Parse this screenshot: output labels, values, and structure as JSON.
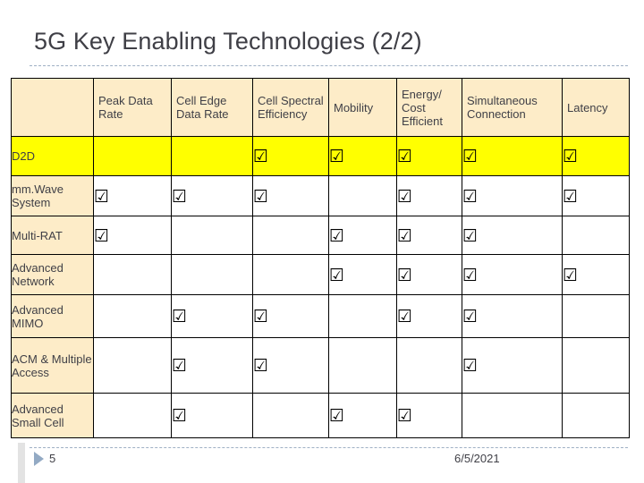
{
  "slide": {
    "title": "5G Key Enabling Technologies (2/2)",
    "footer": {
      "page_number": "5",
      "date": "6/5/2021",
      "triangle_icon": "play-triangle-icon"
    },
    "colors": {
      "header_fill": "#FDECC8",
      "highlight_fill": "#FFFF00",
      "title_text": "#3F3F46",
      "border": "#000000",
      "rule": "#9FB0C4",
      "triangle": "#93AAC4"
    }
  },
  "table": {
    "corner_label": "",
    "columns": [
      "Peak Data Rate",
      "Cell Edge Data Rate",
      "Cell Spectral Efficiency",
      "Mobility",
      "Energy/ Cost Efficient",
      "Simultaneous Connection",
      "Latency"
    ],
    "check_glyph": "☑",
    "rows": [
      {
        "label": "D2D",
        "highlight": true,
        "marks": [
          false,
          false,
          true,
          true,
          true,
          true,
          true
        ]
      },
      {
        "label": "mm.Wave System",
        "highlight": false,
        "marks": [
          true,
          true,
          true,
          false,
          true,
          true,
          true
        ]
      },
      {
        "label": "Multi-RAT",
        "highlight": false,
        "marks": [
          true,
          false,
          false,
          true,
          true,
          true,
          false
        ]
      },
      {
        "label": "Advanced Network",
        "highlight": false,
        "marks": [
          false,
          false,
          false,
          true,
          true,
          true,
          true
        ]
      },
      {
        "label": "Advanced MIMO",
        "highlight": false,
        "marks": [
          false,
          true,
          true,
          false,
          true,
          true,
          false
        ]
      },
      {
        "label": "ACM & Multiple Access",
        "highlight": false,
        "marks": [
          false,
          true,
          true,
          false,
          false,
          true,
          false
        ]
      },
      {
        "label": "Advanced Small Cell",
        "highlight": false,
        "marks": [
          false,
          true,
          false,
          true,
          true,
          false,
          false
        ]
      }
    ]
  }
}
